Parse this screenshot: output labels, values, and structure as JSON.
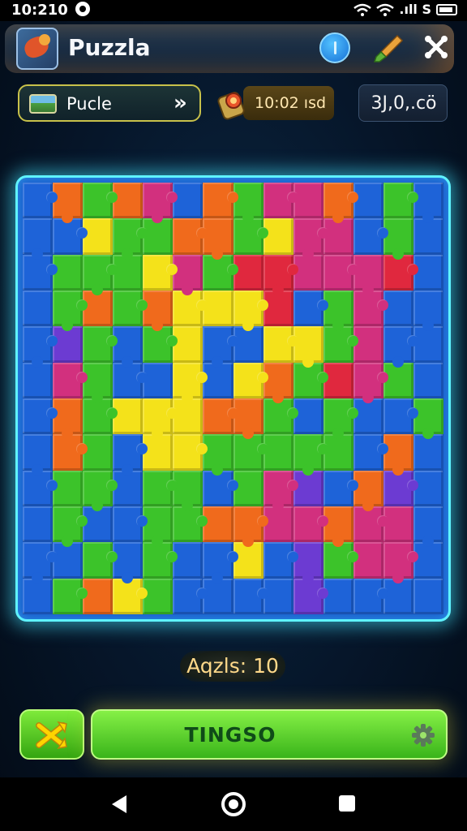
{
  "status_bar": {
    "time": "10:210",
    "signal_text": ".ıll S"
  },
  "header": {
    "app_title": "Puzzla",
    "icons": [
      "app-logo-icon",
      "info-icon",
      "paintbrush-icon",
      "close-icon"
    ]
  },
  "subheader": {
    "puzzle_label": "Pucle",
    "timer_text": "10:02 ısd",
    "score_text": "3J,0,.cö"
  },
  "board": {
    "palette": {
      "B": "#1e63d8",
      "G": "#3cc32a",
      "Y": "#f4e21a",
      "R": "#e0283e",
      "O": "#f06a1c",
      "P": "#d2307e",
      "V": "#6c3bd2"
    },
    "rows": [
      "BOGOPBOGPPOBGB",
      "BBYGGOOGYPPBGB",
      "BGGGYPGRRPPPRB",
      "BGOGOYYYRBGPBB",
      "BVGBGYBBYYGPBB",
      "BPGBBYBYOGRPGB",
      "BOGYYYOOGBGBBG",
      "BOGBYYGGGGGBOB",
      "BGGBGGBGPVBOVB",
      "BGBBGGOOPPOPPB",
      "BBGBGBBYBVGPPB",
      "BGOYGBBBBVBBBB"
    ]
  },
  "moves_text": "Aqzls: 10",
  "bottom": {
    "main_button_label": "TINGSO"
  }
}
